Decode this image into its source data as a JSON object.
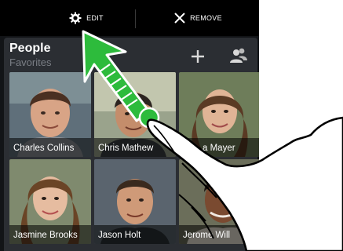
{
  "top_bar": {
    "edit_label": "EDIT",
    "remove_label": "REMOVE"
  },
  "widget": {
    "title": "People",
    "subtitle": "Favorites",
    "add_icon": "plus-icon",
    "people_icon": "people-icon"
  },
  "contacts": [
    {
      "name": "Charles Collins"
    },
    {
      "name": "Chris Mathew"
    },
    {
      "name": "a Mayer"
    },
    {
      "name": "Jasmine Brooks"
    },
    {
      "name": "Jason Holt"
    },
    {
      "name": "Jerome Will"
    }
  ],
  "colors": {
    "accent_green": "#2dbb3c",
    "panel": "#2b2e33",
    "topbar": "#000000"
  }
}
